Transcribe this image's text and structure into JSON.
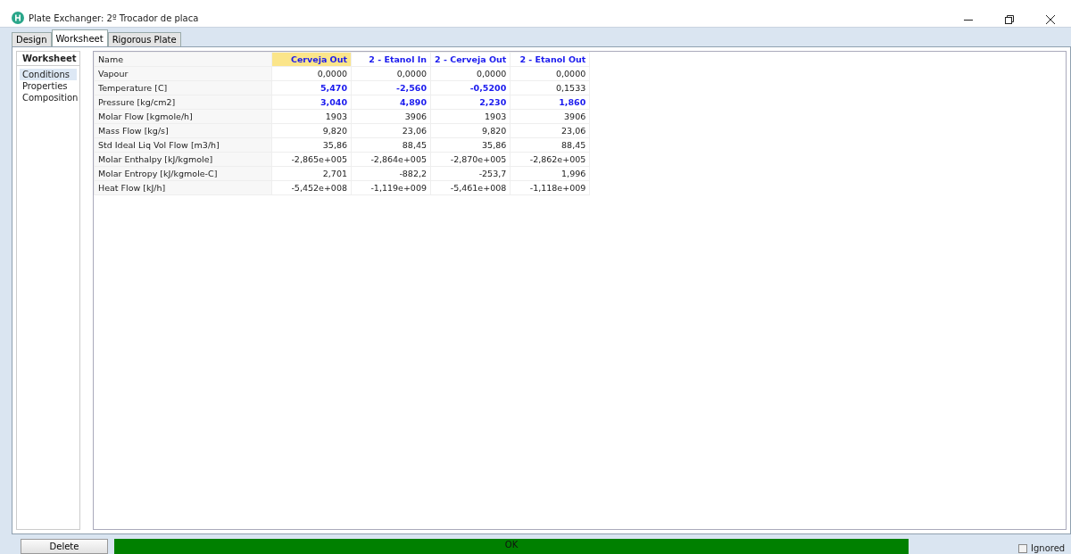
{
  "window": {
    "title": "Plate Exchanger: 2º Trocador de placa"
  },
  "tabs": [
    {
      "label": "Design",
      "selected": false
    },
    {
      "label": "Worksheet",
      "selected": true
    },
    {
      "label": "Rigorous Plate",
      "selected": false
    }
  ],
  "sidebar": {
    "title": "Worksheet",
    "items": [
      {
        "label": "Conditions",
        "selected": true
      },
      {
        "label": "Properties",
        "selected": false
      },
      {
        "label": "Composition",
        "selected": false
      }
    ]
  },
  "table": {
    "name_header": "Name",
    "columns": [
      {
        "label": "Cerveja Out",
        "selected": true
      },
      {
        "label": "2 - Etanol In",
        "selected": false
      },
      {
        "label": "2 - Cerveja Out",
        "selected": false
      },
      {
        "label": "2 - Etanol Out",
        "selected": false
      }
    ],
    "rows": [
      {
        "name": "Vapour",
        "cells": [
          {
            "value": "0,0000",
            "specified": false
          },
          {
            "value": "0,0000",
            "specified": false
          },
          {
            "value": "0,0000",
            "specified": false
          },
          {
            "value": "0,0000",
            "specified": false
          }
        ]
      },
      {
        "name": "Temperature [C]",
        "cells": [
          {
            "value": "5,470",
            "specified": true
          },
          {
            "value": "-2,560",
            "specified": true
          },
          {
            "value": "-0,5200",
            "specified": true
          },
          {
            "value": "0,1533",
            "specified": false
          }
        ]
      },
      {
        "name": "Pressure [kg/cm2]",
        "cells": [
          {
            "value": "3,040",
            "specified": true
          },
          {
            "value": "4,890",
            "specified": true
          },
          {
            "value": "2,230",
            "specified": true
          },
          {
            "value": "1,860",
            "specified": true
          }
        ]
      },
      {
        "name": "Molar Flow [kgmole/h]",
        "cells": [
          {
            "value": "1903",
            "specified": false
          },
          {
            "value": "3906",
            "specified": false
          },
          {
            "value": "1903",
            "specified": false
          },
          {
            "value": "3906",
            "specified": false
          }
        ]
      },
      {
        "name": "Mass Flow [kg/s]",
        "cells": [
          {
            "value": "9,820",
            "specified": false
          },
          {
            "value": "23,06",
            "specified": false
          },
          {
            "value": "9,820",
            "specified": false
          },
          {
            "value": "23,06",
            "specified": false
          }
        ]
      },
      {
        "name": "Std Ideal Liq Vol Flow [m3/h]",
        "cells": [
          {
            "value": "35,86",
            "specified": false
          },
          {
            "value": "88,45",
            "specified": false
          },
          {
            "value": "35,86",
            "specified": false
          },
          {
            "value": "88,45",
            "specified": false
          }
        ]
      },
      {
        "name": "Molar Enthalpy [kJ/kgmole]",
        "cells": [
          {
            "value": "-2,865e+005",
            "specified": false
          },
          {
            "value": "-2,864e+005",
            "specified": false
          },
          {
            "value": "-2,870e+005",
            "specified": false
          },
          {
            "value": "-2,862e+005",
            "specified": false
          }
        ]
      },
      {
        "name": "Molar Entropy [kJ/kgmole-C]",
        "cells": [
          {
            "value": "2,701",
            "specified": false
          },
          {
            "value": "-882,2",
            "specified": false
          },
          {
            "value": "-253,7",
            "specified": false
          },
          {
            "value": "1,996",
            "specified": false
          }
        ]
      },
      {
        "name": "Heat Flow [kJ/h]",
        "cells": [
          {
            "value": "-5,452e+008",
            "specified": false
          },
          {
            "value": "-1,119e+009",
            "specified": false
          },
          {
            "value": "-5,461e+008",
            "specified": false
          },
          {
            "value": "-1,118e+009",
            "specified": false
          }
        ]
      }
    ]
  },
  "footer": {
    "delete_button": "Delete",
    "status": "OK",
    "ignored": {
      "label": "Ignored",
      "checked": false
    }
  }
}
